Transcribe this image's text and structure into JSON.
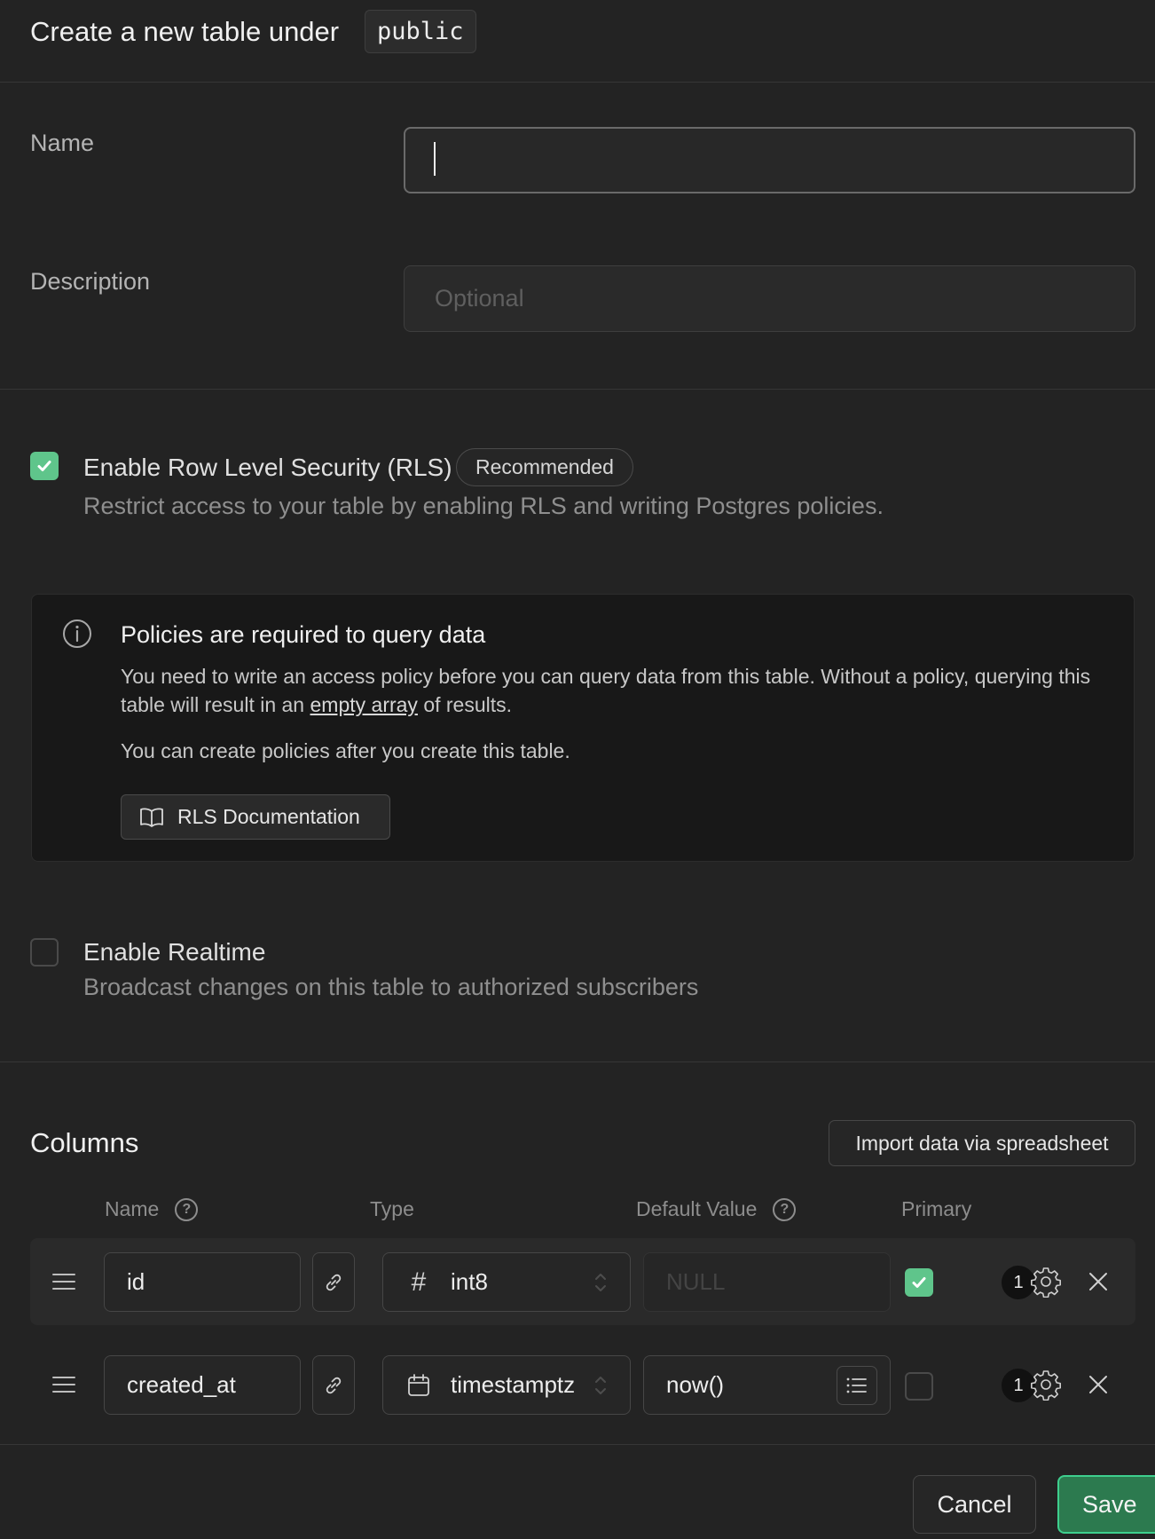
{
  "header": {
    "title": "Create a new table under",
    "schema": "public"
  },
  "form": {
    "name_label": "Name",
    "name_value": "",
    "description_label": "Description",
    "description_placeholder": "Optional"
  },
  "rls": {
    "checked": true,
    "title": "Enable Row Level Security (RLS)",
    "badge": "Recommended",
    "description": "Restrict access to your table by enabling RLS and writing Postgres policies."
  },
  "alert": {
    "title": "Policies are required to query data",
    "body_before": "You need to write an access policy before you can query data from this table. Without a policy, querying this table will result in an ",
    "body_link": "empty array",
    "body_after": " of results.",
    "body2": "You can create policies after you create this table.",
    "button": "RLS Documentation"
  },
  "realtime": {
    "checked": false,
    "title": "Enable Realtime",
    "description": "Broadcast changes on this table to authorized subscribers"
  },
  "columns": {
    "title": "Columns",
    "import_button": "Import data via spreadsheet",
    "headers": {
      "name": "Name",
      "type": "Type",
      "default": "Default Value",
      "primary": "Primary"
    },
    "rows": [
      {
        "name": "id",
        "type_icon": "hash-icon",
        "type": "int8",
        "default": "",
        "default_placeholder": "NULL",
        "primary": true,
        "count": "1"
      },
      {
        "name": "created_at",
        "type_icon": "calendar-icon",
        "type": "timestamptz",
        "default": "now()",
        "default_placeholder": "",
        "primary": false,
        "count": "1"
      }
    ]
  },
  "footer": {
    "cancel": "Cancel",
    "save": "Save"
  },
  "colors": {
    "accent": "#3ecf8e",
    "checkbox": "#5fc58b",
    "background": "#232323"
  }
}
